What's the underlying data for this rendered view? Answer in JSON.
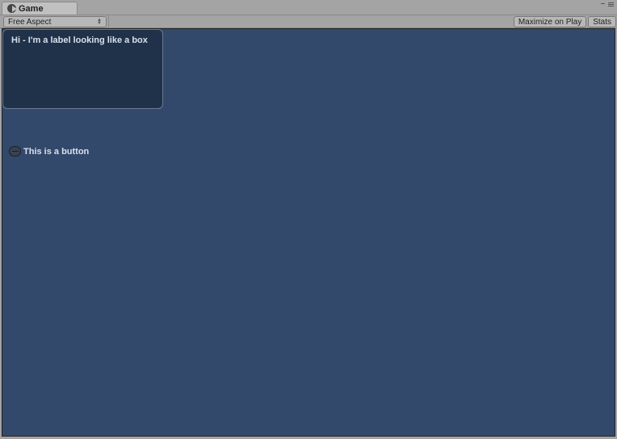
{
  "tab": {
    "title": "Game"
  },
  "toolbar": {
    "aspect_label": "Free Aspect",
    "maximize_label": "Maximize on Play",
    "stats_label": "Stats"
  },
  "viewport": {
    "box_label_text": "Hi - I'm a label looking like a box",
    "toggle_label": "This is a button"
  }
}
